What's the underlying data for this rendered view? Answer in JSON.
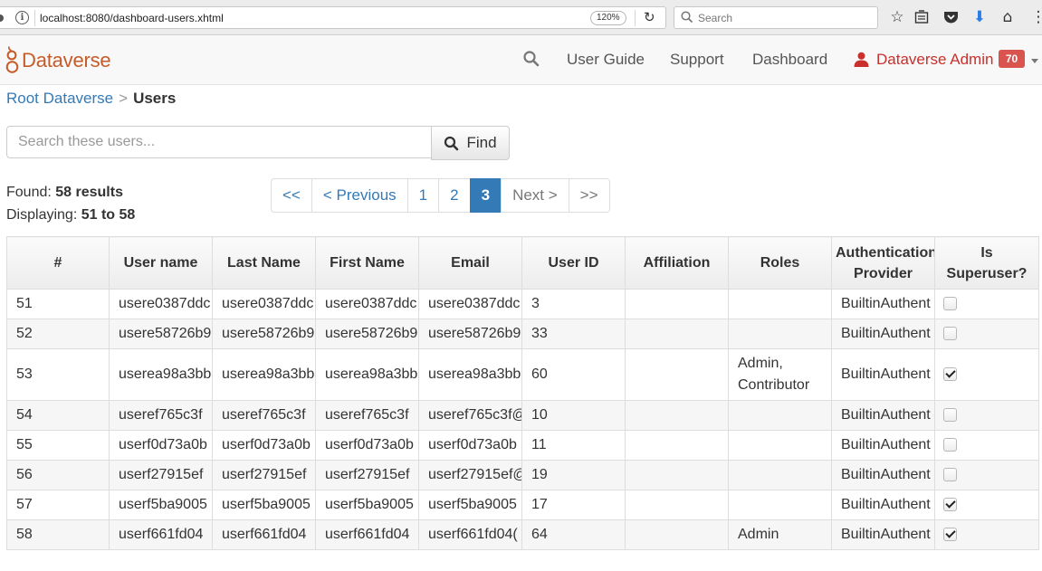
{
  "browser": {
    "url": "localhost:8080/dashboard-users.xhtml",
    "zoom": "120%",
    "search_placeholder": "Search"
  },
  "navbar": {
    "brand": "Dataverse",
    "user_guide": "User Guide",
    "support": "Support",
    "dashboard": "Dashboard",
    "user_name": "Dataverse Admin",
    "notification_count": "70"
  },
  "breadcrumb": {
    "root": "Root Dataverse",
    "separator": ">",
    "current": "Users"
  },
  "search": {
    "placeholder": "Search these users...",
    "find_label": "Find"
  },
  "summary": {
    "found_label": "Found:",
    "found_value": "58 results",
    "displaying_label": "Displaying:",
    "displaying_value": "51 to 58"
  },
  "pagination": {
    "first": "<<",
    "previous": "< Previous",
    "pages": [
      "1",
      "2",
      "3"
    ],
    "next": "Next >",
    "last": ">>"
  },
  "table": {
    "headers": {
      "num": "#",
      "username": "User name",
      "last_name": "Last Name",
      "first_name": "First Name",
      "email": "Email",
      "user_id": "User ID",
      "affiliation": "Affiliation",
      "roles": "Roles",
      "auth_provider": "Authentication Provider",
      "superuser": "Is Superuser?"
    },
    "rows": [
      {
        "num": "51",
        "username": "usere0387ddc",
        "last_name": "usere0387ddc",
        "first_name": "usere0387ddc",
        "email": "usere0387ddc",
        "user_id": "3",
        "affiliation": "",
        "roles": "",
        "auth_provider": "BuiltinAuthent",
        "superuser": false
      },
      {
        "num": "52",
        "username": "usere58726b9",
        "last_name": "usere58726b9",
        "first_name": "usere58726b9",
        "email": "usere58726b9",
        "user_id": "33",
        "affiliation": "",
        "roles": "",
        "auth_provider": "BuiltinAuthent",
        "superuser": false
      },
      {
        "num": "53",
        "username": "userea98a3bb",
        "last_name": "userea98a3bb",
        "first_name": "userea98a3bb",
        "email": "userea98a3bb",
        "user_id": "60",
        "affiliation": "",
        "roles": "Admin,\nContributor",
        "auth_provider": "BuiltinAuthent",
        "superuser": true
      },
      {
        "num": "54",
        "username": "useref765c3f",
        "last_name": "useref765c3f",
        "first_name": "useref765c3f",
        "email": "useref765c3f@",
        "user_id": "10",
        "affiliation": "",
        "roles": "",
        "auth_provider": "BuiltinAuthent",
        "superuser": false
      },
      {
        "num": "55",
        "username": "userf0d73a0b",
        "last_name": "userf0d73a0b",
        "first_name": "userf0d73a0b",
        "email": "userf0d73a0b",
        "user_id": "11",
        "affiliation": "",
        "roles": "",
        "auth_provider": "BuiltinAuthent",
        "superuser": false
      },
      {
        "num": "56",
        "username": "userf27915ef",
        "last_name": "userf27915ef",
        "first_name": "userf27915ef",
        "email": "userf27915ef@",
        "user_id": "19",
        "affiliation": "",
        "roles": "",
        "auth_provider": "BuiltinAuthent",
        "superuser": false
      },
      {
        "num": "57",
        "username": "userf5ba9005",
        "last_name": "userf5ba9005",
        "first_name": "userf5ba9005",
        "email": "userf5ba9005",
        "user_id": "17",
        "affiliation": "",
        "roles": "",
        "auth_provider": "BuiltinAuthent",
        "superuser": true
      },
      {
        "num": "58",
        "username": "userf661fd04",
        "last_name": "userf661fd04",
        "first_name": "userf661fd04",
        "email": "userf661fd04(",
        "user_id": "64",
        "affiliation": "",
        "roles": "Admin",
        "auth_provider": "BuiltinAuthent",
        "superuser": true
      }
    ]
  }
}
